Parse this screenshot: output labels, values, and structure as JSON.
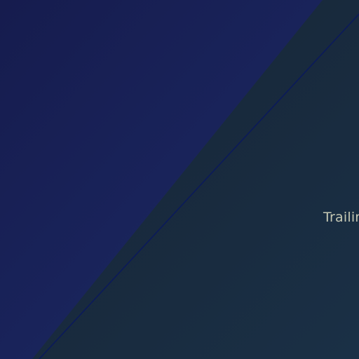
{
  "canvas": {
    "label": "Trailing",
    "colors": {
      "upper_panel": "#1a2458",
      "lower_panel": "#172636",
      "divider_line": "#0b1a5a",
      "label_text": "#c5c8b4"
    }
  }
}
